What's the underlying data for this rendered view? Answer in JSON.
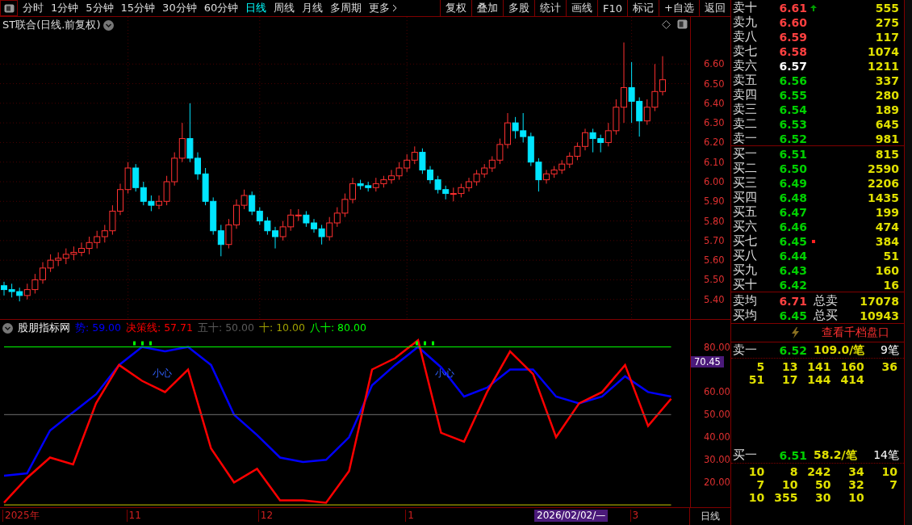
{
  "toolbar": {
    "periods": [
      {
        "label": "分时",
        "selected": false
      },
      {
        "label": "1分钟",
        "selected": false
      },
      {
        "label": "5分钟",
        "selected": false
      },
      {
        "label": "15分钟",
        "selected": false
      },
      {
        "label": "30分钟",
        "selected": false
      },
      {
        "label": "60分钟",
        "selected": false
      },
      {
        "label": "日线",
        "selected": true
      },
      {
        "label": "周线",
        "selected": false
      },
      {
        "label": "月线",
        "selected": false
      },
      {
        "label": "多周期",
        "selected": false
      },
      {
        "label": "更多",
        "selected": false
      }
    ],
    "buttons": [
      "复权",
      "叠加",
      "多股",
      "统计",
      "画线",
      "F10",
      "标记",
      "+自选",
      "返回"
    ]
  },
  "price_chart": {
    "title": "ST联合(日线.前复权)",
    "chart_data": {
      "type": "candlestick",
      "ylim": [
        5.3,
        6.84
      ],
      "yticks": [
        {
          "value": 6.6,
          "label": "6.60"
        },
        {
          "value": 6.5,
          "label": "6.50"
        },
        {
          "value": 6.4,
          "label": "6.40"
        },
        {
          "value": 6.3,
          "label": "6.30"
        },
        {
          "value": 6.2,
          "label": "6.20"
        },
        {
          "value": 6.1,
          "label": "6.10"
        },
        {
          "value": 6.0,
          "label": "6.00"
        },
        {
          "value": 5.9,
          "label": "5.90"
        },
        {
          "value": 5.8,
          "label": "5.80"
        },
        {
          "value": 5.7,
          "label": "5.70"
        },
        {
          "value": 5.6,
          "label": "5.60"
        },
        {
          "value": 5.5,
          "label": "5.50"
        },
        {
          "value": 5.4,
          "label": "5.40"
        }
      ],
      "grid": true,
      "ohlc": [
        [
          5.47,
          5.49,
          5.42,
          5.45
        ],
        [
          5.45,
          5.48,
          5.41,
          5.44
        ],
        [
          5.44,
          5.46,
          5.39,
          5.42
        ],
        [
          5.42,
          5.48,
          5.4,
          5.45
        ],
        [
          5.45,
          5.53,
          5.43,
          5.5
        ],
        [
          5.5,
          5.59,
          5.48,
          5.56
        ],
        [
          5.56,
          5.63,
          5.54,
          5.6
        ],
        [
          5.6,
          5.64,
          5.57,
          5.61
        ],
        [
          5.61,
          5.66,
          5.58,
          5.63
        ],
        [
          5.63,
          5.67,
          5.6,
          5.64
        ],
        [
          5.64,
          5.69,
          5.62,
          5.66
        ],
        [
          5.66,
          5.72,
          5.63,
          5.69
        ],
        [
          5.69,
          5.75,
          5.66,
          5.72
        ],
        [
          5.72,
          5.78,
          5.69,
          5.75
        ],
        [
          5.75,
          5.88,
          5.73,
          5.85
        ],
        [
          5.85,
          5.99,
          5.83,
          5.96
        ],
        [
          5.96,
          6.1,
          5.94,
          6.07
        ],
        [
          6.07,
          6.09,
          5.95,
          5.97
        ],
        [
          5.97,
          6.0,
          5.88,
          5.9
        ],
        [
          5.9,
          5.93,
          5.85,
          5.88
        ],
        [
          5.88,
          5.93,
          5.86,
          5.9
        ],
        [
          5.9,
          6.03,
          5.88,
          6.0
        ],
        [
          6.0,
          6.15,
          5.98,
          6.12
        ],
        [
          6.12,
          6.3,
          6.1,
          6.22
        ],
        [
          6.22,
          6.4,
          6.1,
          6.12
        ],
        [
          6.12,
          6.15,
          6.01,
          6.04
        ],
        [
          6.04,
          6.07,
          5.88,
          5.9
        ],
        [
          5.9,
          5.92,
          5.73,
          5.75
        ],
        [
          5.75,
          5.78,
          5.62,
          5.68
        ],
        [
          5.68,
          5.81,
          5.66,
          5.78
        ],
        [
          5.78,
          5.91,
          5.76,
          5.88
        ],
        [
          5.88,
          5.96,
          5.86,
          5.93
        ],
        [
          5.93,
          5.95,
          5.83,
          5.85
        ],
        [
          5.85,
          5.87,
          5.78,
          5.8
        ],
        [
          5.8,
          5.82,
          5.73,
          5.75
        ],
        [
          5.75,
          5.77,
          5.66,
          5.72
        ],
        [
          5.72,
          5.8,
          5.7,
          5.77
        ],
        [
          5.77,
          5.86,
          5.75,
          5.83
        ],
        [
          5.83,
          5.86,
          5.8,
          5.83
        ],
        [
          5.83,
          5.85,
          5.77,
          5.79
        ],
        [
          5.79,
          5.81,
          5.74,
          5.76
        ],
        [
          5.76,
          5.78,
          5.68,
          5.72
        ],
        [
          5.72,
          5.82,
          5.7,
          5.79
        ],
        [
          5.79,
          5.87,
          5.77,
          5.84
        ],
        [
          5.84,
          5.94,
          5.82,
          5.91
        ],
        [
          5.91,
          6.02,
          5.89,
          5.99
        ],
        [
          5.99,
          6.01,
          5.96,
          5.98
        ],
        [
          5.98,
          6.0,
          5.95,
          5.97
        ],
        [
          5.97,
          6.02,
          5.95,
          5.99
        ],
        [
          5.99,
          6.03,
          5.97,
          6.01
        ],
        [
          6.01,
          6.06,
          5.99,
          6.03
        ],
        [
          6.03,
          6.1,
          6.01,
          6.07
        ],
        [
          6.07,
          6.14,
          6.05,
          6.11
        ],
        [
          6.11,
          6.18,
          6.09,
          6.15
        ],
        [
          6.15,
          6.17,
          6.04,
          6.06
        ],
        [
          6.06,
          6.08,
          5.99,
          6.01
        ],
        [
          6.01,
          6.03,
          5.94,
          5.96
        ],
        [
          5.96,
          5.98,
          5.91,
          5.94
        ],
        [
          5.94,
          5.97,
          5.9,
          5.94
        ],
        [
          5.94,
          5.99,
          5.92,
          5.97
        ],
        [
          5.97,
          6.02,
          5.95,
          6.0
        ],
        [
          6.0,
          6.06,
          5.98,
          6.04
        ],
        [
          6.04,
          6.09,
          6.02,
          6.07
        ],
        [
          6.07,
          6.13,
          6.05,
          6.11
        ],
        [
          6.11,
          6.22,
          6.09,
          6.19
        ],
        [
          6.19,
          6.35,
          6.17,
          6.3
        ],
        [
          6.3,
          6.33,
          6.22,
          6.26
        ],
        [
          6.26,
          6.35,
          6.2,
          6.23
        ],
        [
          6.23,
          6.25,
          6.08,
          6.1
        ],
        [
          6.1,
          6.12,
          5.95,
          6.01
        ],
        [
          6.01,
          6.06,
          5.99,
          6.04
        ],
        [
          6.04,
          6.08,
          6.02,
          6.06
        ],
        [
          6.06,
          6.11,
          6.04,
          6.09
        ],
        [
          6.09,
          6.15,
          6.07,
          6.13
        ],
        [
          6.13,
          6.2,
          6.11,
          6.18
        ],
        [
          6.18,
          6.27,
          6.16,
          6.25
        ],
        [
          6.25,
          6.27,
          6.15,
          6.22
        ],
        [
          6.22,
          6.24,
          6.15,
          6.2
        ],
        [
          6.2,
          6.3,
          6.18,
          6.26
        ],
        [
          6.26,
          6.42,
          6.24,
          6.38
        ],
        [
          6.38,
          6.71,
          6.3,
          6.48
        ],
        [
          6.48,
          6.61,
          6.3,
          6.41
        ],
        [
          6.41,
          6.43,
          6.23,
          6.31
        ],
        [
          6.31,
          6.42,
          6.29,
          6.38
        ],
        [
          6.38,
          6.6,
          6.36,
          6.46
        ],
        [
          6.46,
          6.64,
          6.44,
          6.52
        ]
      ]
    }
  },
  "indicator": {
    "name": "股朋指标网",
    "legend": [
      {
        "value": ": 59.00"
      },
      {
        "value": ": 57.71"
      },
      {
        "value": ": 50.00"
      },
      {
        "value": ": 10.00"
      },
      {
        "value": ": 80.00"
      }
    ],
    "cursor_value": "70.45",
    "chart_data": {
      "type": "line",
      "ylim": [
        9,
        92
      ],
      "yticks": [
        {
          "value": 20,
          "label": "20.00"
        },
        {
          "value": 30,
          "label": "30.00"
        },
        {
          "value": 40,
          "label": "40.00"
        },
        {
          "value": 50,
          "label": "50.00"
        },
        {
          "value": 60,
          "label": "60.00"
        },
        {
          "value": 80,
          "label": "80.00"
        }
      ],
      "series": [
        {
          "name": "势",
          "color": "#0000ff",
          "values": [
            23,
            24,
            43,
            51,
            59,
            72,
            80,
            78,
            80,
            72,
            50,
            41,
            31,
            29,
            30,
            40,
            63,
            72,
            80,
            71,
            58,
            62,
            70,
            70,
            58,
            55,
            58,
            67,
            60,
            58
          ]
        },
        {
          "name": "决策线",
          "color": "#ff0000",
          "values": [
            11,
            22,
            31,
            28,
            55,
            72,
            65,
            60,
            70,
            35,
            20,
            26,
            12,
            12,
            11,
            25,
            70,
            75,
            83,
            42,
            38,
            60,
            78,
            68,
            40,
            55,
            60,
            72,
            45,
            57
          ]
        },
        {
          "name": "五十",
          "color": "#5a5a5a",
          "values": [
            50,
            50,
            50,
            50,
            50,
            50,
            50,
            50,
            50,
            50,
            50,
            50,
            50,
            50,
            50,
            50,
            50,
            50,
            50,
            50,
            50,
            50,
            50,
            50,
            50,
            50,
            50,
            50,
            50,
            50
          ]
        },
        {
          "name": "十",
          "color": "#a0a000",
          "values": [
            10,
            10,
            10,
            10,
            10,
            10,
            10,
            10,
            10,
            10,
            10,
            10,
            10,
            10,
            10,
            10,
            10,
            10,
            10,
            10,
            10,
            10,
            10,
            10,
            10,
            10,
            10,
            10,
            10,
            10
          ]
        },
        {
          "name": "八十",
          "color": "#00ff00",
          "values": [
            80,
            80,
            80,
            80,
            80,
            80,
            80,
            80,
            80,
            80,
            80,
            80,
            80,
            80,
            80,
            80,
            80,
            80,
            80,
            80,
            80,
            80,
            80,
            80,
            80,
            80,
            80,
            80,
            80,
            80
          ]
        }
      ],
      "annotations": [
        "小心",
        "小心"
      ]
    }
  },
  "date_axis": {
    "labels": [
      "2025年",
      "11",
      "12",
      "1",
      "3"
    ],
    "cursor_date": "2026/02/02/—",
    "period": "日线"
  },
  "order_book": {
    "sell": [
      {
        "label": "卖十",
        "price": "6.61",
        "color": "#ff4040",
        "kind": "arrow",
        "volume": "555"
      },
      {
        "label": "卖九",
        "price": "6.60",
        "color": "#ff4040",
        "kind": "plain",
        "volume": "275"
      },
      {
        "label": "卖八",
        "price": "6.59",
        "color": "#ff4040",
        "kind": "plain",
        "volume": "117"
      },
      {
        "label": "卖七",
        "price": "6.58",
        "color": "#ff4040",
        "kind": "plain",
        "volume": "1074"
      },
      {
        "label": "卖六",
        "price": "6.57",
        "color": "#ffffff",
        "kind": "plain",
        "volume": "1211"
      },
      {
        "label": "卖五",
        "price": "6.56",
        "color": "#00d000",
        "kind": "plain",
        "volume": "337"
      },
      {
        "label": "卖四",
        "price": "6.55",
        "color": "#00d000",
        "kind": "plain",
        "volume": "280"
      },
      {
        "label": "卖三",
        "price": "6.54",
        "color": "#00d000",
        "kind": "plain",
        "volume": "189"
      },
      {
        "label": "卖二",
        "price": "6.53",
        "color": "#00d000",
        "kind": "plain",
        "volume": "645"
      },
      {
        "label": "卖一",
        "price": "6.52",
        "color": "#00d000",
        "kind": "plain",
        "volume": "981"
      }
    ],
    "buy": [
      {
        "label": "买一",
        "price": "6.51",
        "color": "#00d000",
        "kind": "plain",
        "volume": "815"
      },
      {
        "label": "买二",
        "price": "6.50",
        "color": "#00d000",
        "kind": "plain",
        "volume": "2590"
      },
      {
        "label": "买三",
        "price": "6.49",
        "color": "#00d000",
        "kind": "plain",
        "volume": "2206"
      },
      {
        "label": "买四",
        "price": "6.48",
        "color": "#00d000",
        "kind": "plain",
        "volume": "1435"
      },
      {
        "label": "买五",
        "price": "6.47",
        "color": "#00d000",
        "kind": "plain",
        "volume": "199"
      },
      {
        "label": "买六",
        "price": "6.46",
        "color": "#00d000",
        "kind": "plain",
        "volume": "474"
      },
      {
        "label": "买七",
        "price": "6.45",
        "color": "#00d000",
        "kind": "dot",
        "volume": "384"
      },
      {
        "label": "买八",
        "price": "6.44",
        "color": "#00d000",
        "kind": "plain",
        "volume": "51"
      },
      {
        "label": "买九",
        "price": "6.43",
        "color": "#00d000",
        "kind": "plain",
        "volume": "160"
      },
      {
        "label": "买十",
        "price": "6.42",
        "color": "#00d000",
        "kind": "plain",
        "volume": "16"
      }
    ],
    "averages": [
      {
        "label": "卖均",
        "price": "6.71",
        "color": "#ff4040",
        "total_label": "总卖",
        "total": "17078"
      },
      {
        "label": "买均",
        "price": "6.45",
        "color": "#00d000",
        "total_label": "总买",
        "total": "10943"
      }
    ],
    "depth_link": "查看千档盘口",
    "queues": [
      {
        "label": "卖一",
        "price": "6.52",
        "average": "109.0/笔",
        "count": "9笔",
        "rows": [
          [
            "5",
            "13",
            "141",
            "160",
            "36"
          ],
          [
            "51",
            "17",
            "144",
            "414"
          ]
        ]
      },
      {
        "label": "买一",
        "price": "6.51",
        "average": "58.2/笔",
        "count": "14笔",
        "rows": [
          [
            "10",
            "8",
            "242",
            "34",
            "10"
          ],
          [
            "7",
            "10",
            "50",
            "32",
            "7"
          ],
          [
            "10",
            "355",
            "30",
            "10"
          ]
        ]
      }
    ]
  }
}
